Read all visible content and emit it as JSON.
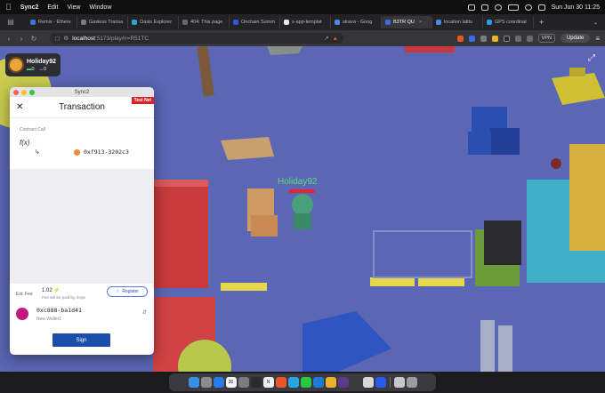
{
  "menubar": {
    "app_name": "Sync2",
    "items": [
      "Edit",
      "View",
      "Window"
    ],
    "clock": "Sun Jun 30  11:25"
  },
  "browser": {
    "tabs": [
      {
        "label": "Remix - Ethere",
        "color": "#3e74d8"
      },
      {
        "label": "Gasless Transa",
        "color": "#7a7a80"
      },
      {
        "label": "Oasis Explorer",
        "color": "#2aa3d8"
      },
      {
        "label": "404: This page",
        "color": "#6a6a70"
      },
      {
        "label": "Onchain Summ",
        "color": "#2c5ae8"
      },
      {
        "label": "x-app-templat",
        "color": "#e8e8ea"
      },
      {
        "label": "strava - Goog",
        "color": "#4c8ae8"
      },
      {
        "label": "B3TR QU",
        "color": "#3a6ee8",
        "active": true
      },
      {
        "label": "location latitu",
        "color": "#4c8ae8"
      },
      {
        "label": "GPS coordinat",
        "color": "#2c9ae8"
      }
    ],
    "url_host": "localhost",
    "url_path": ":5173/play#r=R51TC",
    "vpn_label": "VPN",
    "update_label": "Update"
  },
  "game": {
    "player_card": {
      "name": "Holiday92",
      "coins": "0",
      "items": "0"
    },
    "player_nametag": "Holiday92"
  },
  "wallet": {
    "window_title": "Sync2",
    "network_badge": "Test Net",
    "header_title": "Transaction",
    "contract_label": "Contract Call",
    "function_symbol": "f(x)",
    "contract_address": "0xf913-3202c3",
    "fee_label": "Est. Fee",
    "fee_value": "1.02 ⚡",
    "fee_note": "Fee will be paid by dApp",
    "register_label": "Register",
    "wallet_address": "0xc888-ba1d41",
    "wallet_name": "New Wallet1",
    "sign_label": "Sign"
  },
  "dock": {
    "apps": [
      {
        "name": "finder",
        "color": "#3b8ee0"
      },
      {
        "name": "launchpad",
        "color": "#8a8a90"
      },
      {
        "name": "safari",
        "color": "#2c7be5"
      },
      {
        "name": "calendar",
        "color": "#f4f4f4",
        "text": "30"
      },
      {
        "name": "system-settings",
        "color": "#7a7a80"
      },
      {
        "name": "terminal",
        "color": "#2a2a2e"
      },
      {
        "name": "notion",
        "color": "#f0f0f0",
        "text": "N"
      },
      {
        "name": "brave",
        "color": "#e8572a"
      },
      {
        "name": "telegram",
        "color": "#2aa3e0"
      },
      {
        "name": "whatsapp",
        "color": "#28c840"
      },
      {
        "name": "vscode",
        "color": "#1f7ad4"
      },
      {
        "name": "chrome",
        "color": "#e8b32a"
      },
      {
        "name": "github-desktop",
        "color": "#5a3a8a"
      },
      {
        "name": "cursor",
        "color": "#3a3a3e"
      },
      {
        "name": "slack",
        "color": "#d8d8dc"
      },
      {
        "name": "vechain-sync",
        "color": "#2a5ae8"
      },
      {
        "name": "preview",
        "color": "#c8c8cc"
      },
      {
        "name": "trash",
        "color": "#9a9aa0"
      }
    ]
  }
}
